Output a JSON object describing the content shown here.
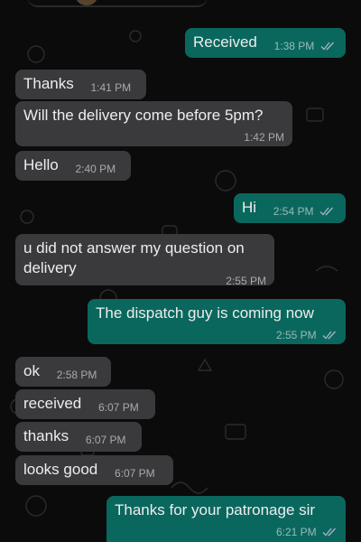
{
  "messages": [
    {
      "direction": "outgoing",
      "text": "Received",
      "time": "1:38 PM",
      "read": true
    },
    {
      "direction": "incoming",
      "text": "Thanks",
      "time": "1:41 PM"
    },
    {
      "direction": "incoming",
      "text": "Will the delivery come before 5pm?",
      "time": "1:42 PM"
    },
    {
      "direction": "incoming",
      "text": "Hello",
      "time": "2:40 PM"
    },
    {
      "direction": "outgoing",
      "text": "Hi",
      "time": "2:54 PM",
      "read": true
    },
    {
      "direction": "incoming",
      "text": "u did not answer my question on delivery",
      "time": "2:55 PM"
    },
    {
      "direction": "outgoing",
      "text": "The dispatch guy is coming now",
      "time": "2:55 PM",
      "read": true
    },
    {
      "direction": "incoming",
      "text": "ok",
      "time": "2:58 PM"
    },
    {
      "direction": "incoming",
      "text": "received",
      "time": "6:07 PM"
    },
    {
      "direction": "incoming",
      "text": "thanks",
      "time": "6:07 PM"
    },
    {
      "direction": "incoming",
      "text": "looks good",
      "time": "6:07 PM"
    },
    {
      "direction": "outgoing",
      "text": "Thanks for your patronage sir",
      "time": "6:21 PM",
      "read": true
    }
  ],
  "colors": {
    "background": "#0b0b0b",
    "incoming_bubble": "#3a3a3c",
    "outgoing_bubble": "#0a675d",
    "read_receipt": "#9fb3c8"
  },
  "icons": {
    "read_receipt": "double-check-icon",
    "header_avatar": "avatar"
  }
}
